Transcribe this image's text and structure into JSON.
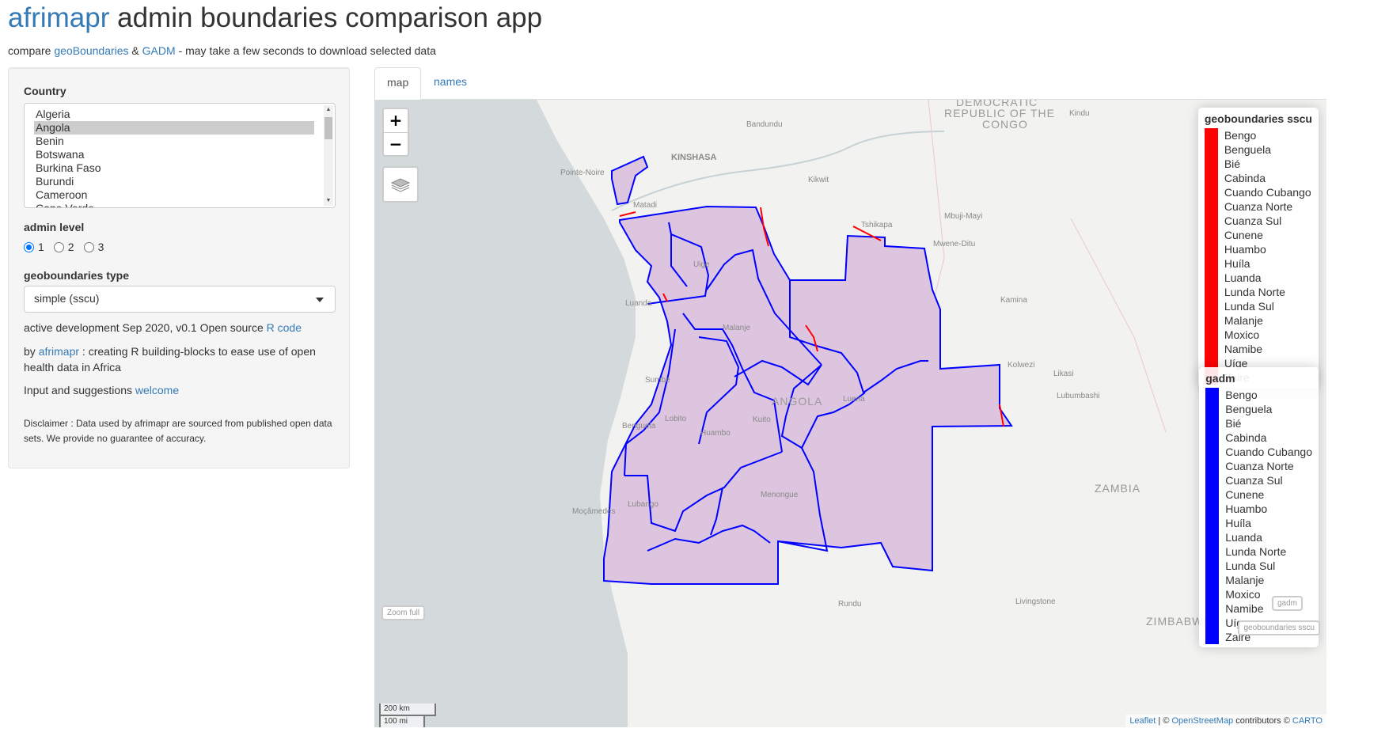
{
  "header": {
    "title_brand": "afrimapr",
    "title_rest": "admin boundaries comparison app",
    "subtitle_prefix": "compare ",
    "subtitle_link1": "geoBoundaries",
    "subtitle_amp": " & ",
    "subtitle_link2": "GADM",
    "subtitle_suffix": " - may take a few seconds to download selected data"
  },
  "sidebar": {
    "country_label": "Country",
    "countries": [
      "Algeria",
      "Angola",
      "Benin",
      "Botswana",
      "Burkina Faso",
      "Burundi",
      "Cameroon",
      "Cape Verde"
    ],
    "selected_country": "Angola",
    "admin_label": "admin level",
    "admin_options": [
      "1",
      "2",
      "3"
    ],
    "admin_selected": "1",
    "type_label": "geoboundaries type",
    "type_value": "simple (sscu)",
    "dev_text": "active development Sep 2020, v0.1 Open source ",
    "dev_link": "R code",
    "by_prefix": "by ",
    "by_link": "afrimapr",
    "by_suffix": " : creating R building-blocks to ease use of open health data in Africa",
    "input_text": "Input and suggestions ",
    "input_link": "welcome",
    "disclaimer": "Disclaimer : Data used by afrimapr are sourced from published open data sets. We provide no guarantee of accuracy."
  },
  "tabs": [
    {
      "label": "map",
      "active": true
    },
    {
      "label": "names",
      "active": false
    }
  ],
  "map": {
    "zoom_in": "+",
    "zoom_out": "−",
    "zoom_full": "Zoom full",
    "scale_km": "200 km",
    "scale_mi": "100 mi",
    "attribution_leaflet": "Leaflet",
    "attribution_mid1": " | © ",
    "attribution_osm": "OpenStreetMap",
    "attribution_mid2": " contributors © ",
    "attribution_carto": "CARTO",
    "btn_gadm": "gadm",
    "btn_geob": "geoboundaries sscu",
    "place_labels": [
      "DEMOCRATIC",
      "REPUBLIC OF THE",
      "CONGO",
      "Kindu",
      "Bandundu",
      "KINSHASA",
      "Pointe-Noire",
      "Kikwit",
      "Matadi",
      "Tshikapa",
      "Mbuji-Mayi",
      "Mwene-Ditu",
      "Uige",
      "Luanda",
      "Kamina",
      "Malanje",
      "Kolwezi",
      "Likasi",
      "Lubumbashi",
      "Sumbe",
      "ANGOLA",
      "Luena",
      "Benguela",
      "Lobito",
      "Kuito",
      "Huambo",
      "ZAMBIA",
      "Moçâmedes",
      "Lubango",
      "Menongue",
      "Livingstone",
      "Rundu",
      "ZIMBABWE"
    ],
    "legend_geob": {
      "title": "geoboundaries sscu",
      "color": "#ff0000",
      "items": [
        "Bengo",
        "Benguela",
        "Bié",
        "Cabinda",
        "Cuando Cubango",
        "Cuanza Norte",
        "Cuanza Sul",
        "Cunene",
        "Huambo",
        "Huíla",
        "Luanda",
        "Lunda Norte",
        "Lunda Sul",
        "Malanje",
        "Moxico",
        "Namibe",
        "Uíge",
        "Zaire"
      ]
    },
    "legend_gadm": {
      "title": "gadm",
      "color": "#0000ff",
      "items": [
        "Bengo",
        "Benguela",
        "Bié",
        "Cabinda",
        "Cuando Cubango",
        "Cuanza Norte",
        "Cuanza Sul",
        "Cunene",
        "Huambo",
        "Huíla",
        "Luanda",
        "Lunda Norte",
        "Lunda Sul",
        "Malanje",
        "Moxico",
        "Namibe",
        "Uíge",
        "Zaire"
      ]
    },
    "colors": {
      "sea": "#d4dadc",
      "land": "#f2f2f0",
      "fill": "#ddc5e0",
      "gadm": "#0000ff",
      "geob": "#ff0000"
    }
  }
}
